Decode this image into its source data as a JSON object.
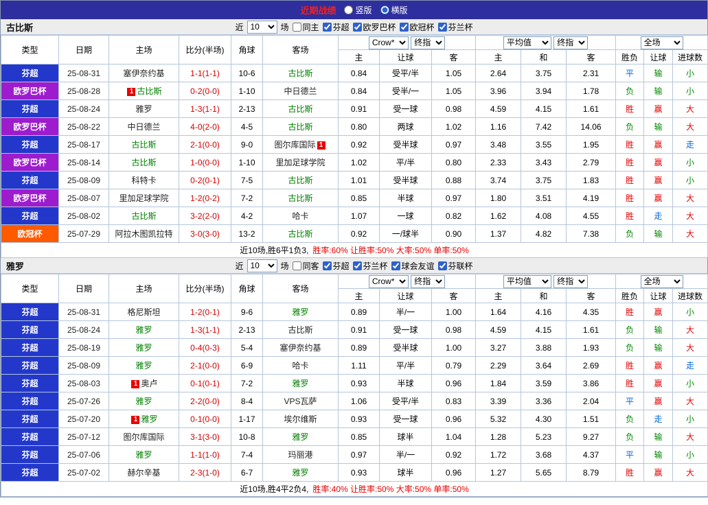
{
  "titlebar": {
    "title": "近期战绩",
    "vertical": "竖版",
    "horizontal": "横版"
  },
  "controls": {
    "near": "近",
    "count": "10",
    "matches": "场"
  },
  "table_header": {
    "col_type": "类型",
    "col_date": "日期",
    "col_home": "主场",
    "col_score": "比分(半场)",
    "col_corner": "角球",
    "col_away": "客场",
    "sel_source": "Crow*",
    "sel_final1": "终指",
    "sel_avg": "平均值",
    "sel_final2": "终指",
    "sel_full": "全场",
    "sub_ah_home": "主",
    "sub_ah_line": "让球",
    "sub_ah_away": "客",
    "sub_avg_home": "主",
    "sub_avg_draw": "和",
    "sub_avg_away": "客",
    "sub_result": "胜负",
    "sub_handicap": "让球",
    "sub_goals": "进球数"
  },
  "league_colors": {
    "芬超": "#2338cb",
    "欧罗巴杯": "#9d1ccd",
    "欧冠杯": "#ff5a00"
  },
  "red_card_badge": "1",
  "colors": {
    "titlebar_bg": "#2e2e9e",
    "title_text": "#ee2222",
    "section_header_bg": "#ededed",
    "table_border": "#b4c6dc",
    "outer_border": "#8496ad",
    "self_team": "#008000",
    "score_text": "#d50000",
    "result_win": "#e60000",
    "result_lose": "#008800",
    "result_push": "#0066dd"
  },
  "sections": [
    {
      "team": "古比斯",
      "same_venue": "同主",
      "leagues": [
        "芬超",
        "欧罗巴杯",
        "欧冠杯",
        "芬兰杯"
      ],
      "rows": [
        {
          "league": "芬超",
          "date": "25-08-31",
          "home": "塞伊奈约基",
          "score": "1-1(1-1)",
          "corner": "10-6",
          "away": "古比斯",
          "away_self": true,
          "ah": [
            "0.84",
            "受平/半",
            "1.05"
          ],
          "avg": [
            "2.64",
            "3.75",
            "2.31"
          ],
          "res": [
            "平",
            "输",
            "小"
          ]
        },
        {
          "league": "欧罗巴杯",
          "date": "25-08-28",
          "home": "古比斯",
          "home_self": true,
          "home_rc": "pre",
          "score": "0-2(0-0)",
          "corner": "1-10",
          "away": "中日德兰",
          "ah": [
            "0.84",
            "受半/一",
            "1.05"
          ],
          "avg": [
            "3.96",
            "3.94",
            "1.78"
          ],
          "res": [
            "负",
            "输",
            "小"
          ]
        },
        {
          "league": "芬超",
          "date": "25-08-24",
          "home": "雅罗",
          "score": "1-3(1-1)",
          "corner": "2-13",
          "away": "古比斯",
          "away_self": true,
          "ah": [
            "0.91",
            "受一球",
            "0.98"
          ],
          "avg": [
            "4.59",
            "4.15",
            "1.61"
          ],
          "res": [
            "胜",
            "赢",
            "大"
          ]
        },
        {
          "league": "欧罗巴杯",
          "date": "25-08-22",
          "home": "中日德兰",
          "score": "4-0(2-0)",
          "corner": "4-5",
          "away": "古比斯",
          "away_self": true,
          "ah": [
            "0.80",
            "两球",
            "1.02"
          ],
          "avg": [
            "1.16",
            "7.42",
            "14.06"
          ],
          "res": [
            "负",
            "输",
            "大"
          ]
        },
        {
          "league": "芬超",
          "date": "25-08-17",
          "home": "古比斯",
          "home_self": true,
          "score": "2-1(0-0)",
          "corner": "9-0",
          "away": "图尔库国际",
          "away_rc": "post",
          "ah": [
            "0.92",
            "受半球",
            "0.97"
          ],
          "avg": [
            "3.48",
            "3.55",
            "1.95"
          ],
          "res": [
            "胜",
            "赢",
            "走"
          ]
        },
        {
          "league": "欧罗巴杯",
          "date": "25-08-14",
          "home": "古比斯",
          "home_self": true,
          "score": "1-0(0-0)",
          "corner": "1-10",
          "away": "里加足球学院",
          "ah": [
            "1.02",
            "平/半",
            "0.80"
          ],
          "avg": [
            "2.33",
            "3.43",
            "2.79"
          ],
          "res": [
            "胜",
            "赢",
            "小"
          ]
        },
        {
          "league": "芬超",
          "date": "25-08-09",
          "home": "科特卡",
          "score": "0-2(0-1)",
          "corner": "7-5",
          "away": "古比斯",
          "away_self": true,
          "ah": [
            "1.01",
            "受半球",
            "0.88"
          ],
          "avg": [
            "3.74",
            "3.75",
            "1.83"
          ],
          "res": [
            "胜",
            "赢",
            "小"
          ]
        },
        {
          "league": "欧罗巴杯",
          "date": "25-08-07",
          "home": "里加足球学院",
          "score": "1-2(0-2)",
          "corner": "7-2",
          "away": "古比斯",
          "away_self": true,
          "ah": [
            "0.85",
            "半球",
            "0.97"
          ],
          "avg": [
            "1.80",
            "3.51",
            "4.19"
          ],
          "res": [
            "胜",
            "赢",
            "大"
          ]
        },
        {
          "league": "芬超",
          "date": "25-08-02",
          "home": "古比斯",
          "home_self": true,
          "score": "3-2(2-0)",
          "corner": "4-2",
          "away": "哈卡",
          "ah": [
            "1.07",
            "一球",
            "0.82"
          ],
          "avg": [
            "1.62",
            "4.08",
            "4.55"
          ],
          "res": [
            "胜",
            "走",
            "大"
          ]
        },
        {
          "league": "欧冠杯",
          "date": "25-07-29",
          "home": "阿拉木图凯拉特",
          "score": "3-0(3-0)",
          "corner": "13-2",
          "away": "古比斯",
          "away_self": true,
          "ah": [
            "0.92",
            "一/球半",
            "0.90"
          ],
          "avg": [
            "1.37",
            "4.82",
            "7.38"
          ],
          "res": [
            "负",
            "输",
            "大"
          ]
        }
      ],
      "summary": {
        "prefix": "近10场,胜6平1负3,",
        "stats": "胜率:60% 让胜率:50% 大率:50% 单率:50%"
      }
    },
    {
      "team": "雅罗",
      "same_venue": "同客",
      "leagues": [
        "芬超",
        "芬兰杯",
        "球会友谊",
        "芬联杯"
      ],
      "rows": [
        {
          "league": "芬超",
          "date": "25-08-31",
          "home": "格尼斯坦",
          "score": "1-2(0-1)",
          "corner": "9-6",
          "away": "雅罗",
          "away_self": true,
          "ah": [
            "0.89",
            "半/一",
            "1.00"
          ],
          "avg": [
            "1.64",
            "4.16",
            "4.35"
          ],
          "res": [
            "胜",
            "赢",
            "小"
          ]
        },
        {
          "league": "芬超",
          "date": "25-08-24",
          "home": "雅罗",
          "home_self": true,
          "score": "1-3(1-1)",
          "corner": "2-13",
          "away": "古比斯",
          "ah": [
            "0.91",
            "受一球",
            "0.98"
          ],
          "avg": [
            "4.59",
            "4.15",
            "1.61"
          ],
          "res": [
            "负",
            "输",
            "大"
          ]
        },
        {
          "league": "芬超",
          "date": "25-08-19",
          "home": "雅罗",
          "home_self": true,
          "score": "0-4(0-3)",
          "corner": "5-4",
          "away": "塞伊奈约基",
          "ah": [
            "0.89",
            "受半球",
            "1.00"
          ],
          "avg": [
            "3.27",
            "3.88",
            "1.93"
          ],
          "res": [
            "负",
            "输",
            "大"
          ]
        },
        {
          "league": "芬超",
          "date": "25-08-09",
          "home": "雅罗",
          "home_self": true,
          "score": "2-1(0-0)",
          "corner": "6-9",
          "away": "哈卡",
          "ah": [
            "1.11",
            "平/半",
            "0.79"
          ],
          "avg": [
            "2.29",
            "3.64",
            "2.69"
          ],
          "res": [
            "胜",
            "赢",
            "走"
          ]
        },
        {
          "league": "芬超",
          "date": "25-08-03",
          "home": "奥卢",
          "home_rc": "pre",
          "score": "0-1(0-1)",
          "corner": "7-2",
          "away": "雅罗",
          "away_self": true,
          "ah": [
            "0.93",
            "半球",
            "0.96"
          ],
          "avg": [
            "1.84",
            "3.59",
            "3.86"
          ],
          "res": [
            "胜",
            "赢",
            "小"
          ]
        },
        {
          "league": "芬超",
          "date": "25-07-26",
          "home": "雅罗",
          "home_self": true,
          "score": "2-2(0-0)",
          "corner": "8-4",
          "away": "VPS瓦萨",
          "ah": [
            "1.06",
            "受平/半",
            "0.83"
          ],
          "avg": [
            "3.39",
            "3.36",
            "2.04"
          ],
          "res": [
            "平",
            "赢",
            "大"
          ]
        },
        {
          "league": "芬超",
          "date": "25-07-20",
          "home": "雅罗",
          "home_self": true,
          "home_rc": "pre",
          "score": "0-1(0-0)",
          "corner": "1-17",
          "away": "埃尔维斯",
          "ah": [
            "0.93",
            "受一球",
            "0.96"
          ],
          "avg": [
            "5.32",
            "4.30",
            "1.51"
          ],
          "res": [
            "负",
            "走",
            "小"
          ]
        },
        {
          "league": "芬超",
          "date": "25-07-12",
          "home": "图尔库国际",
          "score": "3-1(3-0)",
          "corner": "10-8",
          "away": "雅罗",
          "away_self": true,
          "ah": [
            "0.85",
            "球半",
            "1.04"
          ],
          "avg": [
            "1.28",
            "5.23",
            "9.27"
          ],
          "res": [
            "负",
            "输",
            "大"
          ]
        },
        {
          "league": "芬超",
          "date": "25-07-06",
          "home": "雅罗",
          "home_self": true,
          "score": "1-1(1-0)",
          "corner": "7-4",
          "away": "玛丽港",
          "ah": [
            "0.97",
            "半/一",
            "0.92"
          ],
          "avg": [
            "1.72",
            "3.68",
            "4.37"
          ],
          "res": [
            "平",
            "输",
            "小"
          ]
        },
        {
          "league": "芬超",
          "date": "25-07-02",
          "home": "赫尔辛基",
          "score": "2-3(1-0)",
          "corner": "6-7",
          "away": "雅罗",
          "away_self": true,
          "ah": [
            "0.93",
            "球半",
            "0.96"
          ],
          "avg": [
            "1.27",
            "5.65",
            "8.79"
          ],
          "res": [
            "胜",
            "赢",
            "大"
          ]
        }
      ],
      "summary": {
        "prefix": "近10场,胜4平2负4,",
        "stats": "胜率:40% 让胜率:50% 大率:50% 单率:50%"
      }
    }
  ]
}
